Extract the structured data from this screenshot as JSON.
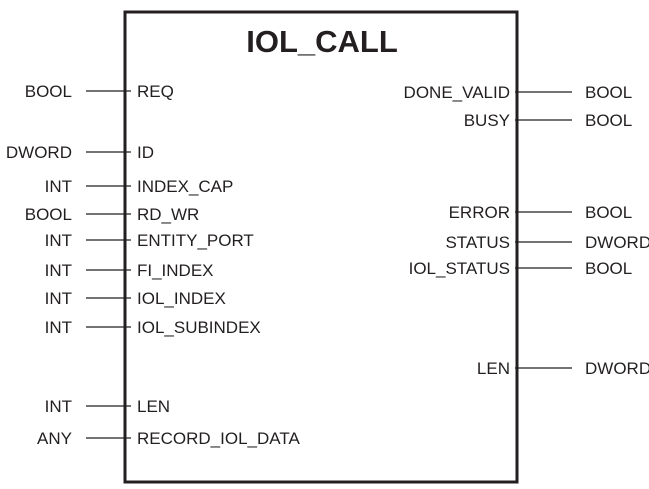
{
  "block": {
    "title": "IOL_CALL"
  },
  "inputs": [
    {
      "pin": "REQ",
      "type": "BOOL"
    },
    {
      "pin": "ID",
      "type": "DWORD"
    },
    {
      "pin": "INDEX_CAP",
      "type": "INT"
    },
    {
      "pin": "RD_WR",
      "type": "BOOL"
    },
    {
      "pin": "ENTITY_PORT",
      "type": "INT"
    },
    {
      "pin": "FI_INDEX",
      "type": "INT"
    },
    {
      "pin": "IOL_INDEX",
      "type": "INT"
    },
    {
      "pin": "IOL_SUBINDEX",
      "type": "INT"
    },
    {
      "pin": "LEN",
      "type": "INT"
    },
    {
      "pin": "RECORD_IOL_DATA",
      "type": "ANY"
    }
  ],
  "outputs": [
    {
      "pin": "DONE_VALID",
      "type": "BOOL"
    },
    {
      "pin": "BUSY",
      "type": "BOOL"
    },
    {
      "pin": "ERROR",
      "type": "BOOL"
    },
    {
      "pin": "STATUS",
      "type": "DWORD"
    },
    {
      "pin": "IOL_STATUS",
      "type": "BOOL"
    },
    {
      "pin": "LEN",
      "type": "DWORD"
    }
  ],
  "colors": {
    "line": "#231f20",
    "background": "#ffffff"
  }
}
